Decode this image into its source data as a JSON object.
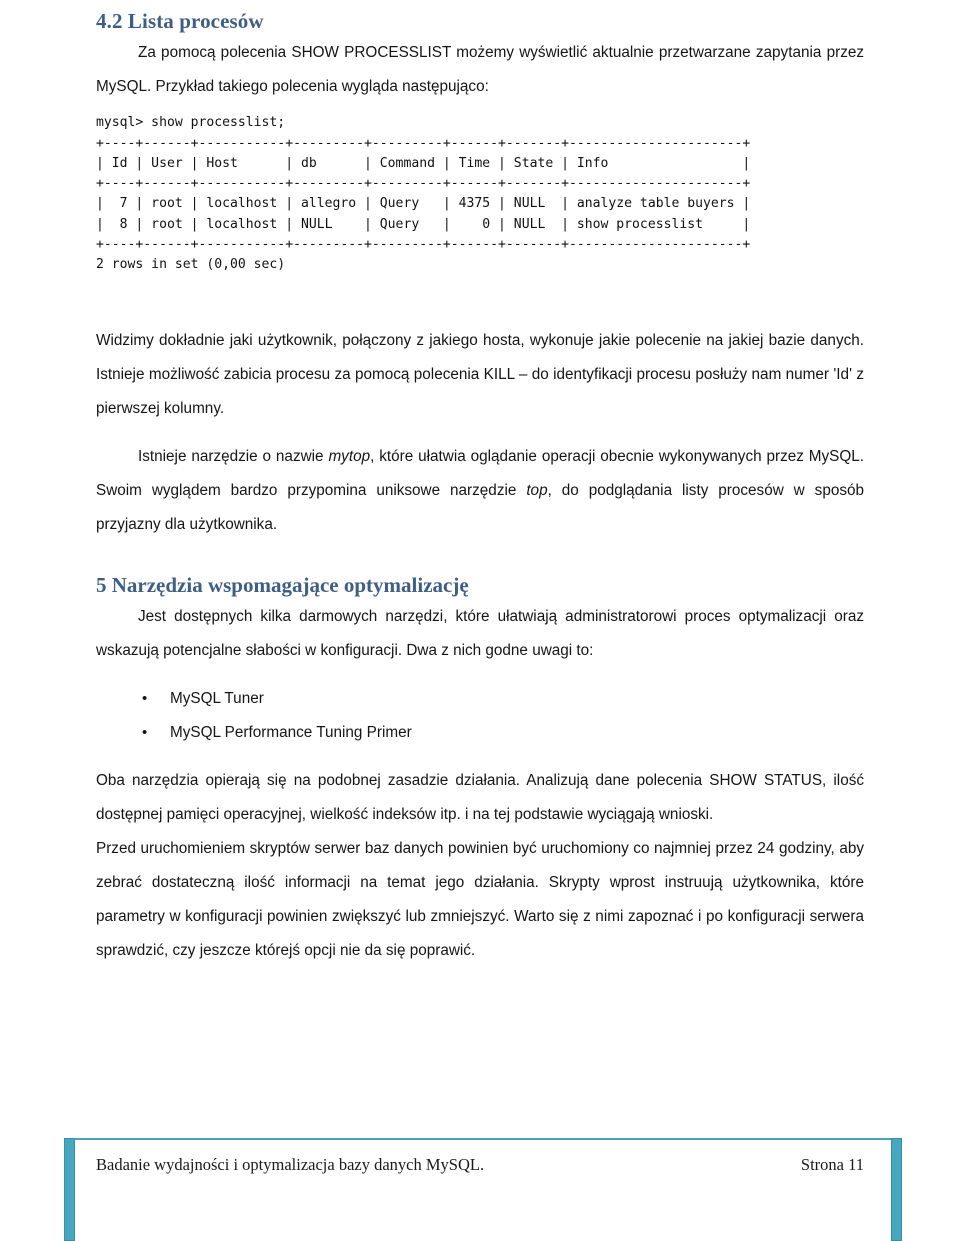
{
  "document": {
    "heading_42": "4.2 Lista procesów",
    "para_intro": "Za pomocą polecenia SHOW PROCESSLIST możemy wyświetlić aktualnie przetwarzane zapytania przez MySQL. Przykład takiego polecenia wygląda następująco:",
    "terminal": {
      "prompt_line": "mysql> show processlist;",
      "separator": "+----+------+-----------+---------+---------+------+-------+----------------------+",
      "header_row": "| Id | User | Host      | db      | Command | Time | State | Info                 |",
      "rows": [
        "|  7 | root | localhost | allegro | Query   | 4375 | NULL  | analyze table buyers |",
        "|  8 | root | localhost | NULL    | Query   |    0 | NULL  | show processlist     |"
      ],
      "result_line": "2 rows in set (0,00 sec)",
      "columns": [
        "Id",
        "User",
        "Host",
        "db",
        "Command",
        "Time",
        "State",
        "Info"
      ],
      "data_rows": [
        {
          "Id": "7",
          "User": "root",
          "Host": "localhost",
          "db": "allegro",
          "Command": "Query",
          "Time": "4375",
          "State": "NULL",
          "Info": "analyze table buyers"
        },
        {
          "Id": "8",
          "User": "root",
          "Host": "localhost",
          "db": "NULL",
          "Command": "Query",
          "Time": "0",
          "State": "NULL",
          "Info": "show processlist"
        }
      ]
    },
    "para_widzimy": "Widzimy dokładnie jaki użytkownik, połączony z jakiego hosta, wykonuje jakie polecenie na jakiej bazie danych. Istnieje możliwość zabicia procesu za pomocą polecenia KILL – do identyfikacji procesu posłuży nam numer 'Id' z pierwszej kolumny.",
    "para_mytop_1": "Istnieje narzędzie o nazwie ",
    "para_mytop_em1": "mytop",
    "para_mytop_2": ", które ułatwia oglądanie operacji obecnie wykonywanych przez MySQL. Swoim wyglądem bardzo przypomina uniksowe narzędzie ",
    "para_mytop_em2": "top",
    "para_mytop_3": ", do podglądania listy procesów w sposób przyjazny dla użytkownika.",
    "heading_5": "5 Narzędzia wspomagające optymalizację",
    "para_jest": "Jest dostępnych kilka darmowych narzędzi, które ułatwiają administratorowi proces optymalizacji oraz wskazują potencjalne słabości w konfiguracji. Dwa z nich godne uwagi to:",
    "tools": [
      {
        "bullet": "•",
        "label": "MySQL Tuner"
      },
      {
        "bullet": "•",
        "label": "MySQL Performance Tuning Primer"
      }
    ],
    "para_oba": "Oba narzędzia opierają się na podobnej zasadzie działania. Analizują dane polecenia SHOW STATUS, ilość dostępnej pamięci operacyjnej, wielkość indeksów itp. i na tej podstawie wyciągają wnioski.",
    "para_przed": "Przed uruchomieniem skryptów serwer baz danych powinien być uruchomiony co najmniej przez 24 godziny, aby zebrać dostateczną ilość informacji na temat jego działania. Skrypty wprost instruują użytkownika, które parametry w konfiguracji powinien zwiększyć lub zmniejszyć. Warto się z nimi zapoznać i po konfiguracji serwera sprawdzić, czy jeszcze którejś opcji nie da się poprawić."
  },
  "footer": {
    "left": "Badanie wydajności i optymalizacja bazy danych MySQL.",
    "right": "Strona 11"
  },
  "colors": {
    "heading": "#3f5e86",
    "accent_bar": "#45a7c0",
    "rule": "#4aa3b8",
    "text": "#151515"
  }
}
